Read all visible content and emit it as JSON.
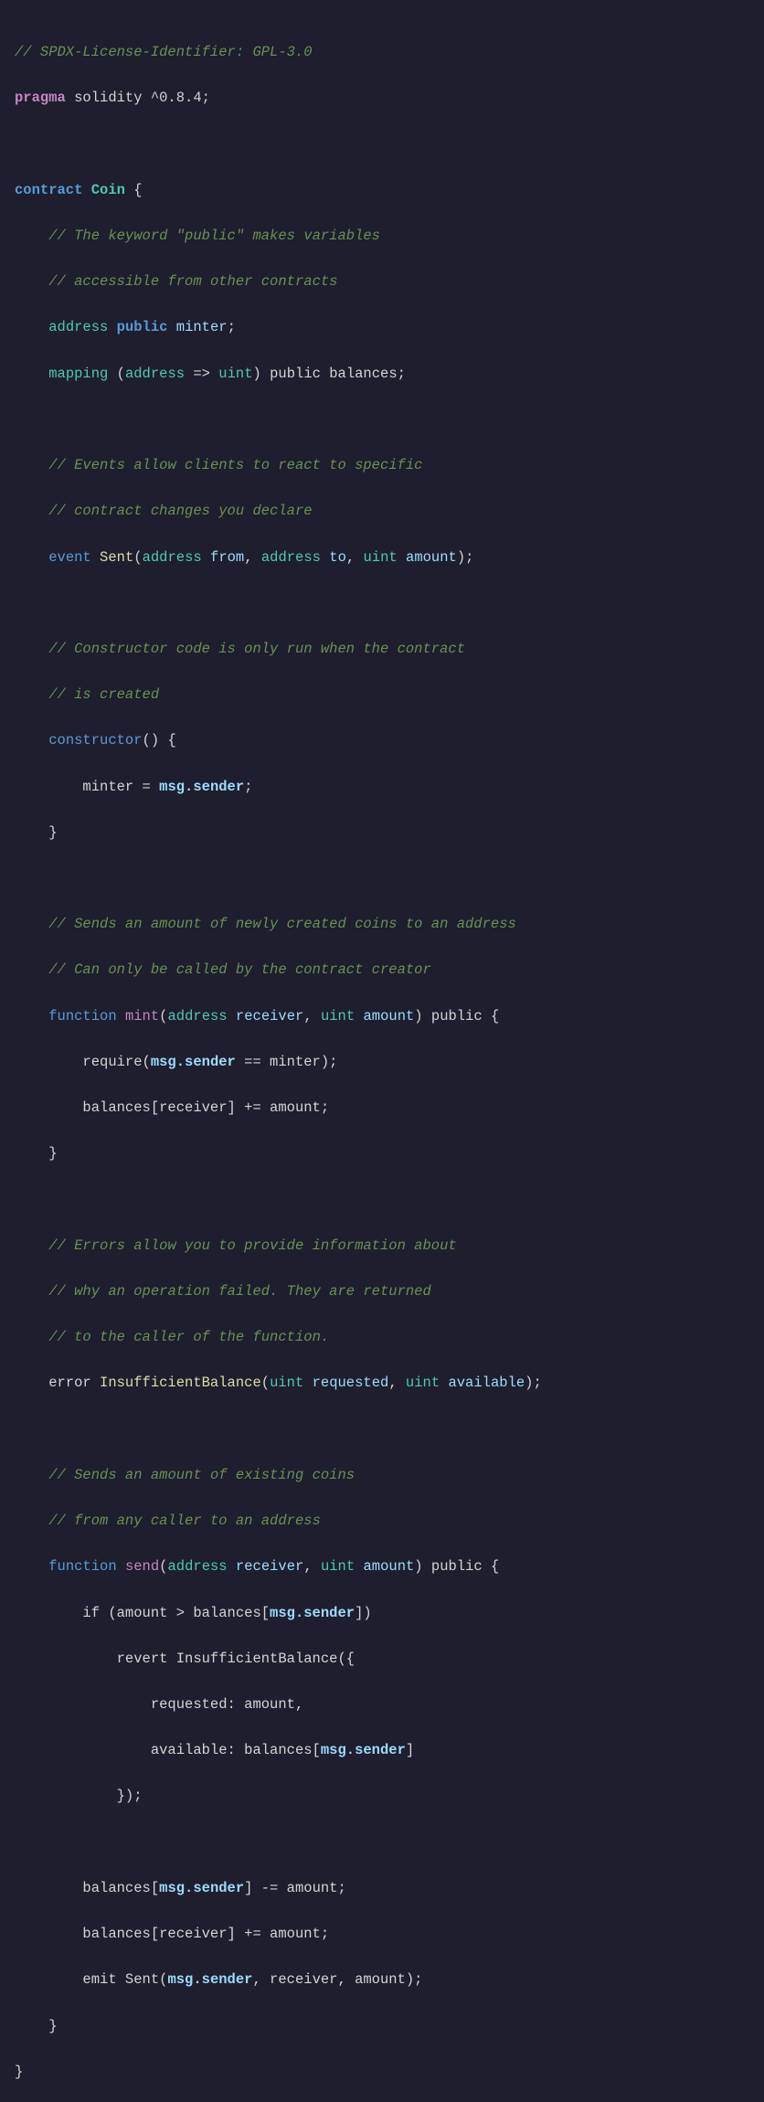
{
  "code": {
    "license_comment": "// SPDX-License-Identifier: GPL-3.0",
    "pragma_line": "pragma solidity ^0.8.4;",
    "contract_keyword": "contract",
    "contract_name": "Coin",
    "comment_public_1": "// The keyword \"public\" makes variables",
    "comment_public_2": "// accessible from other contracts",
    "address_line": "address public minter;",
    "mapping_line": "mapping (address => uint) public balances;",
    "comment_events_1": "// Events allow clients to react to specific",
    "comment_events_2": "// contract changes you declare",
    "event_line": "event Sent(address from, address to, uint amount);",
    "comment_constructor_1": "// Constructor code is only run when the contract",
    "comment_constructor_2": "// is created",
    "constructor_line": "constructor() {",
    "minter_assign": "minter = msg.sender;",
    "comment_mint_1": "// Sends an amount of newly created coins to an address",
    "comment_mint_2": "// Can only be called by the contract creator",
    "function_mint_sig": "function mint(address receiver, uint amount) public {",
    "require_line": "require(msg.sender == minter);",
    "balances_mint": "balances[receiver] += amount;",
    "comment_errors_1": "// Errors allow you to provide information about",
    "comment_errors_2": "// why an operation failed. They are returned",
    "comment_errors_3": "// to the caller of the function.",
    "error_line": "error InsufficientBalance(uint requested, uint available);",
    "comment_send_1": "// Sends an amount of existing coins",
    "comment_send_2": "// from any caller to an address",
    "function_send_sig": "function send(address receiver, uint amount) public {",
    "if_line": "if (amount > balances[msg.sender])",
    "revert_line": "revert InsufficientBalance({",
    "requested_line": "requested: amount,",
    "available_line": "available: balances[msg.sender]",
    "close_revert": "});",
    "balances_subtract": "balances[msg.sender] -= amount;",
    "balances_add": "balances[receiver] += amount;",
    "emit_line": "emit Sent(msg.sender, receiver, amount);"
  },
  "colors": {
    "bg": "#1e1e2e",
    "comment": "#6a9153",
    "keyword": "#569cd6",
    "type": "#4ec9b0",
    "function_name": "#c586c0",
    "param": "#9cdcfe",
    "plain": "#d4d4d4",
    "contract_name": "#4ec9b0",
    "msg_sender": "#9cdcfe",
    "operator": "#d4d4d4",
    "error_name": "#dcdcaa",
    "event_name": "#dcdcaa"
  }
}
